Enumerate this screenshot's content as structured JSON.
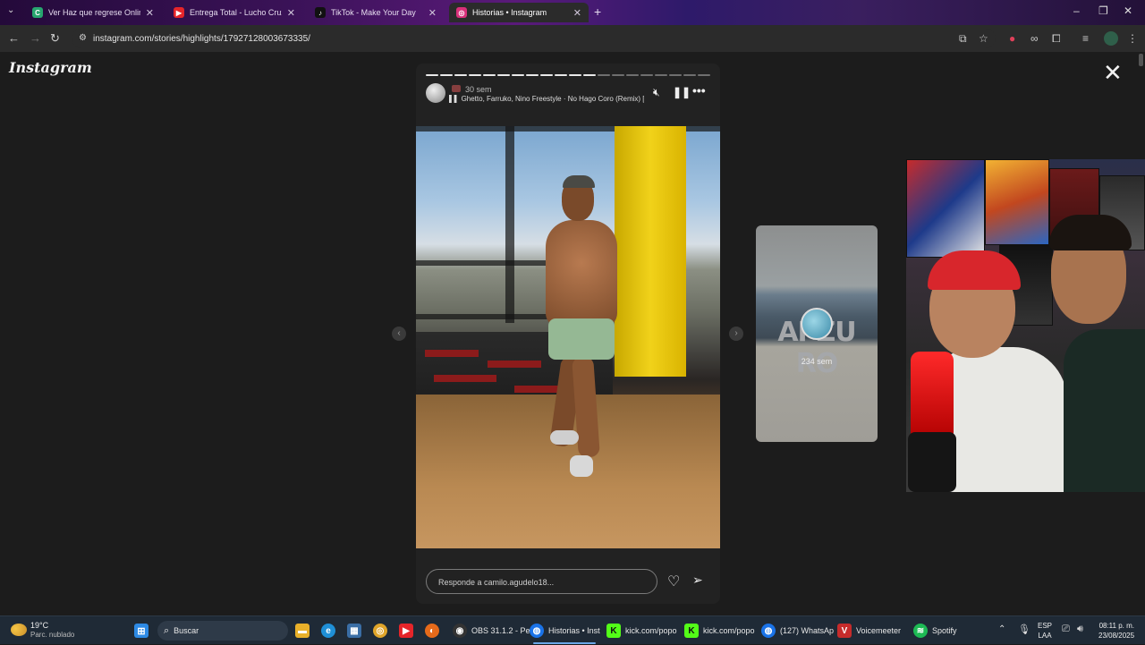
{
  "browser": {
    "tabs": [
      {
        "title": "Ver Haz que regrese Online G",
        "favicon_label": "C",
        "favicon_color": "#27a66f",
        "active": false
      },
      {
        "title": "Entrega Total - Lucho Cruz, vid",
        "favicon_label": "▶",
        "favicon_color": "#e5252a",
        "active": false
      },
      {
        "title": "TikTok - Make Your Day",
        "favicon_label": "♪",
        "favicon_color": "#111111",
        "active": false
      },
      {
        "title": "Historias • Instagram",
        "favicon_label": "◎",
        "favicon_color": "#d9307a",
        "active": true
      }
    ],
    "new_tab": "+",
    "url": "instagram.com/stories/highlights/17927128003673335/"
  },
  "instagram": {
    "logo": "Instagram",
    "close": "✕",
    "story": {
      "progress_total": 20,
      "progress_done": 12,
      "age": "30 sem",
      "music": "Ghetto, Farruko, Nino Freestyle · No Hago Coro (Remix) [fe",
      "reply_placeholder": "Responde a camilo.agudelo18...",
      "more": "•••"
    },
    "next_story": {
      "sign_text": "APZU RO",
      "age": "234 sem"
    },
    "prev_arrow": "‹",
    "next_arrow": "›"
  },
  "taskbar": {
    "weather_temp": "19°C",
    "weather_desc": "Parc. nublado",
    "search_placeholder": "Buscar",
    "apps": [
      {
        "label": "OBS 31.1.2 - Pe",
        "icon": "◉",
        "color": "#333333"
      },
      {
        "label": "Historias • Inst",
        "icon": "◍",
        "color": "#1a73e8"
      },
      {
        "label": "kick.com/popo",
        "icon": "K",
        "color": "#53fc18"
      },
      {
        "label": "kick.com/popo",
        "icon": "K",
        "color": "#53fc18"
      },
      {
        "label": "(127) WhatsAp",
        "icon": "◍",
        "color": "#1a73e8"
      },
      {
        "label": "Voicemeeter",
        "icon": "V",
        "color": "#c62b2b"
      },
      {
        "label": "Spotify",
        "icon": "≋",
        "color": "#1db954"
      }
    ],
    "lang_top": "ESP",
    "lang_bottom": "LAA",
    "time": "08:11 p. m.",
    "date": "23/08/2025"
  },
  "colors": {
    "background": "#1c1c1c",
    "story_bg": "#222222",
    "taskbar": "#1f2a36",
    "accent": "#6aa7e8"
  }
}
